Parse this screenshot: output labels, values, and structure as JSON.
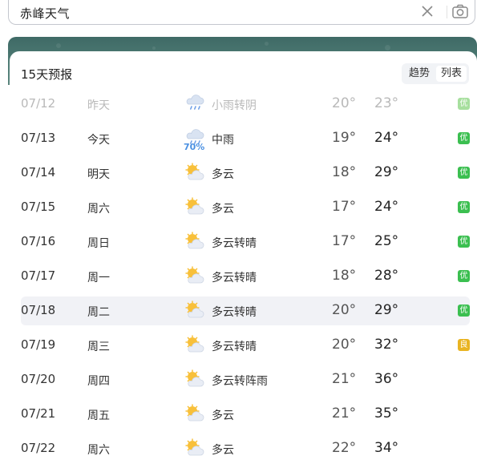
{
  "search": {
    "query": "赤峰天气",
    "clear_icon": "close-icon",
    "camera_icon": "camera-icon"
  },
  "forecast": {
    "title": "15天预报",
    "view_toggle": {
      "trend": "趋势",
      "list": "列表",
      "selected": "列表"
    },
    "days": [
      {
        "date": "07/12",
        "day": "昨天",
        "icon": "rain-cloud-icon",
        "desc": "小雨转阴",
        "low": "20°",
        "high": "23°",
        "aqi": "优",
        "past": true
      },
      {
        "date": "07/13",
        "day": "今天",
        "icon": "rain-cloud-icon",
        "desc": "中雨",
        "precip": "70%",
        "low": "19°",
        "high": "24°",
        "aqi": "优"
      },
      {
        "date": "07/14",
        "day": "明天",
        "icon": "partly-cloudy-icon",
        "desc": "多云",
        "low": "18°",
        "high": "29°",
        "aqi": "优"
      },
      {
        "date": "07/15",
        "day": "周六",
        "icon": "partly-cloudy-icon",
        "desc": "多云",
        "low": "17°",
        "high": "24°",
        "aqi": "优"
      },
      {
        "date": "07/16",
        "day": "周日",
        "icon": "partly-cloudy-icon",
        "desc": "多云转晴",
        "low": "17°",
        "high": "25°",
        "aqi": "优"
      },
      {
        "date": "07/17",
        "day": "周一",
        "icon": "partly-cloudy-icon",
        "desc": "多云转晴",
        "low": "18°",
        "high": "28°",
        "aqi": "优"
      },
      {
        "date": "07/18",
        "day": "周二",
        "icon": "partly-cloudy-icon",
        "desc": "多云转晴",
        "low": "20°",
        "high": "29°",
        "aqi": "优",
        "highlight": true
      },
      {
        "date": "07/19",
        "day": "周三",
        "icon": "partly-cloudy-icon",
        "desc": "多云转晴",
        "low": "20°",
        "high": "32°",
        "aqi": "良"
      },
      {
        "date": "07/20",
        "day": "周四",
        "icon": "partly-cloudy-icon",
        "desc": "多云转阵雨",
        "low": "21°",
        "high": "36°"
      },
      {
        "date": "07/21",
        "day": "周五",
        "icon": "partly-cloudy-icon",
        "desc": "多云",
        "low": "21°",
        "high": "35°"
      },
      {
        "date": "07/22",
        "day": "周六",
        "icon": "partly-cloudy-icon",
        "desc": "多云",
        "low": "22°",
        "high": "34°"
      }
    ]
  },
  "colors": {
    "aqi_good": "#3bbf50",
    "aqi_moderate": "#e9b422",
    "banner": "#4d7a73",
    "highlight_row": "#f1f2f6"
  }
}
